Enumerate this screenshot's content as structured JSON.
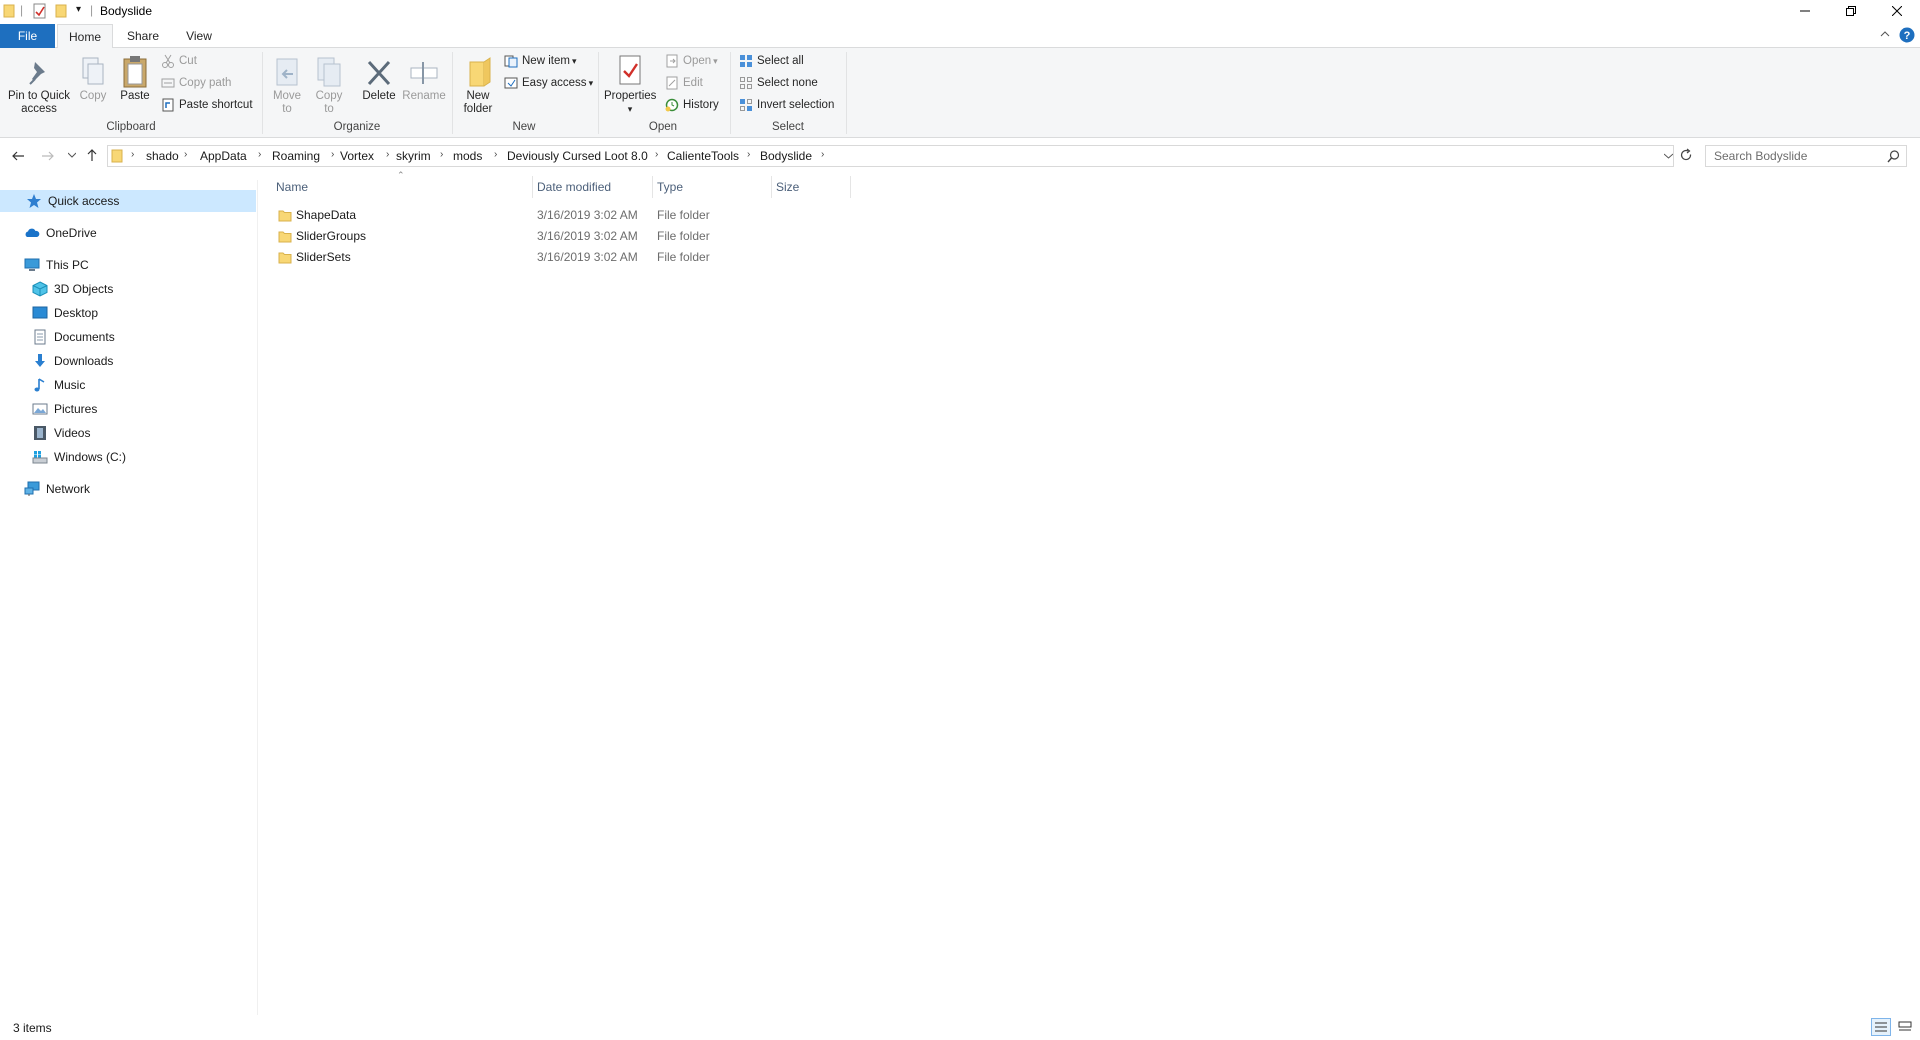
{
  "window": {
    "title": "Bodyslide"
  },
  "tabs": {
    "file": "File",
    "home": "Home",
    "share": "Share",
    "view": "View"
  },
  "ribbon": {
    "clipboard": {
      "pin": "Pin to Quick access",
      "copy": "Copy",
      "paste": "Paste",
      "cut": "Cut",
      "copy_path": "Copy path",
      "paste_shortcut": "Paste shortcut",
      "label": "Clipboard"
    },
    "organize": {
      "move_to": "Move to",
      "copy_to": "Copy to",
      "delete": "Delete",
      "rename": "Rename",
      "label": "Organize"
    },
    "new": {
      "new_folder": "New folder",
      "new_item": "New item",
      "easy_access": "Easy access",
      "label": "New"
    },
    "open": {
      "properties": "Properties",
      "open": "Open",
      "edit": "Edit",
      "history": "History",
      "label": "Open"
    },
    "select": {
      "select_all": "Select all",
      "select_none": "Select none",
      "invert": "Invert selection",
      "label": "Select"
    }
  },
  "address": {
    "crumbs": [
      "shado",
      "AppData",
      "Roaming",
      "Vortex",
      "skyrim",
      "mods",
      "Deviously Cursed Loot 8.0",
      "CalienteTools",
      "Bodyslide"
    ],
    "search_placeholder": "Search Bodyslide"
  },
  "nav": {
    "quick_access": "Quick access",
    "onedrive": "OneDrive",
    "this_pc": "This PC",
    "objects3d": "3D Objects",
    "desktop": "Desktop",
    "documents": "Documents",
    "downloads": "Downloads",
    "music": "Music",
    "pictures": "Pictures",
    "videos": "Videos",
    "windows_c": "Windows (C:)",
    "network": "Network"
  },
  "columns": {
    "name": "Name",
    "date": "Date modified",
    "type": "Type",
    "size": "Size"
  },
  "files": [
    {
      "name": "ShapeData",
      "date": "3/16/2019 3:02 AM",
      "type": "File folder"
    },
    {
      "name": "SliderGroups",
      "date": "3/16/2019 3:02 AM",
      "type": "File folder"
    },
    {
      "name": "SliderSets",
      "date": "3/16/2019 3:02 AM",
      "type": "File folder"
    }
  ],
  "status": {
    "count": "3 items"
  },
  "colors": {
    "accent": "#1e6fbf",
    "selection": "#cce8ff",
    "folder": "#f8d775"
  }
}
